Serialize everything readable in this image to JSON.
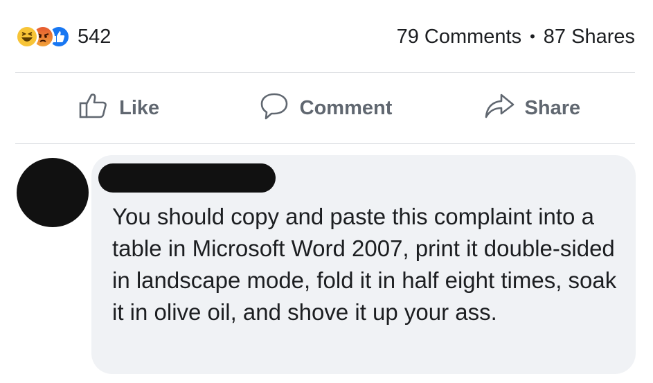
{
  "reactions": {
    "icons": [
      "haha-icon",
      "angry-icon",
      "like-icon"
    ],
    "count": "542"
  },
  "counts": {
    "comments": "79 Comments",
    "separator": "•",
    "shares": "87 Shares"
  },
  "actions": {
    "like": "Like",
    "comment": "Comment",
    "share": "Share"
  },
  "comment": {
    "text": "You should copy and paste this complaint into a table in Microsoft Word 2007, print it double-sided in landscape mode, fold it in half eight times, soak it in olive oil, and shove it up your ass."
  },
  "colors": {
    "like_blue": "#1877f2",
    "action_gray": "#606770",
    "bubble_bg": "#f0f2f5",
    "divider": "#dadde1"
  }
}
